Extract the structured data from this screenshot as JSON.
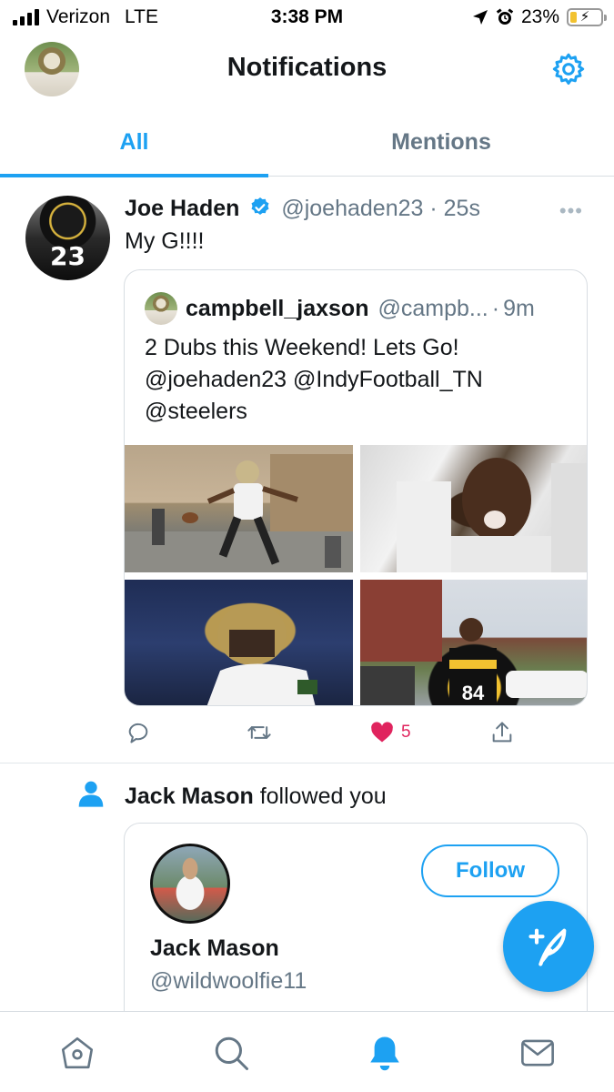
{
  "status_bar": {
    "carrier": "Verizon",
    "network": "LTE",
    "time": "3:38 PM",
    "battery": "23%",
    "battery_level": 0.23
  },
  "header": {
    "title": "Notifications",
    "settings_icon": "gear-icon"
  },
  "tabs": [
    {
      "label": "All",
      "active": true
    },
    {
      "label": "Mentions",
      "active": false
    }
  ],
  "tweet": {
    "name": "Joe Haden",
    "handle": "@joehaden23",
    "separator": "·",
    "time": "25s",
    "text": "My G!!!!",
    "avatar_jersey": "23",
    "quote": {
      "name": "campbell_jaxson",
      "handle": "@campb...",
      "separator": "·",
      "time": "9m",
      "lines": [
        "2 Dubs this Weekend! Lets Go!",
        "@joehaden23 @IndyFootball_TN",
        "@steelers"
      ]
    },
    "actions": {
      "like_count": "5"
    }
  },
  "follow_notification": {
    "who": "Jack Mason",
    "action": " followed you",
    "card": {
      "name": "Jack Mason",
      "handle": "@wildwoolfie11",
      "follow_label": "Follow"
    }
  },
  "colors": {
    "accent": "#1da1f2",
    "like": "#e0245e",
    "secondary_text": "#657786"
  },
  "bottom_nav": [
    "home-icon",
    "search-icon",
    "bell-icon",
    "mail-icon"
  ]
}
